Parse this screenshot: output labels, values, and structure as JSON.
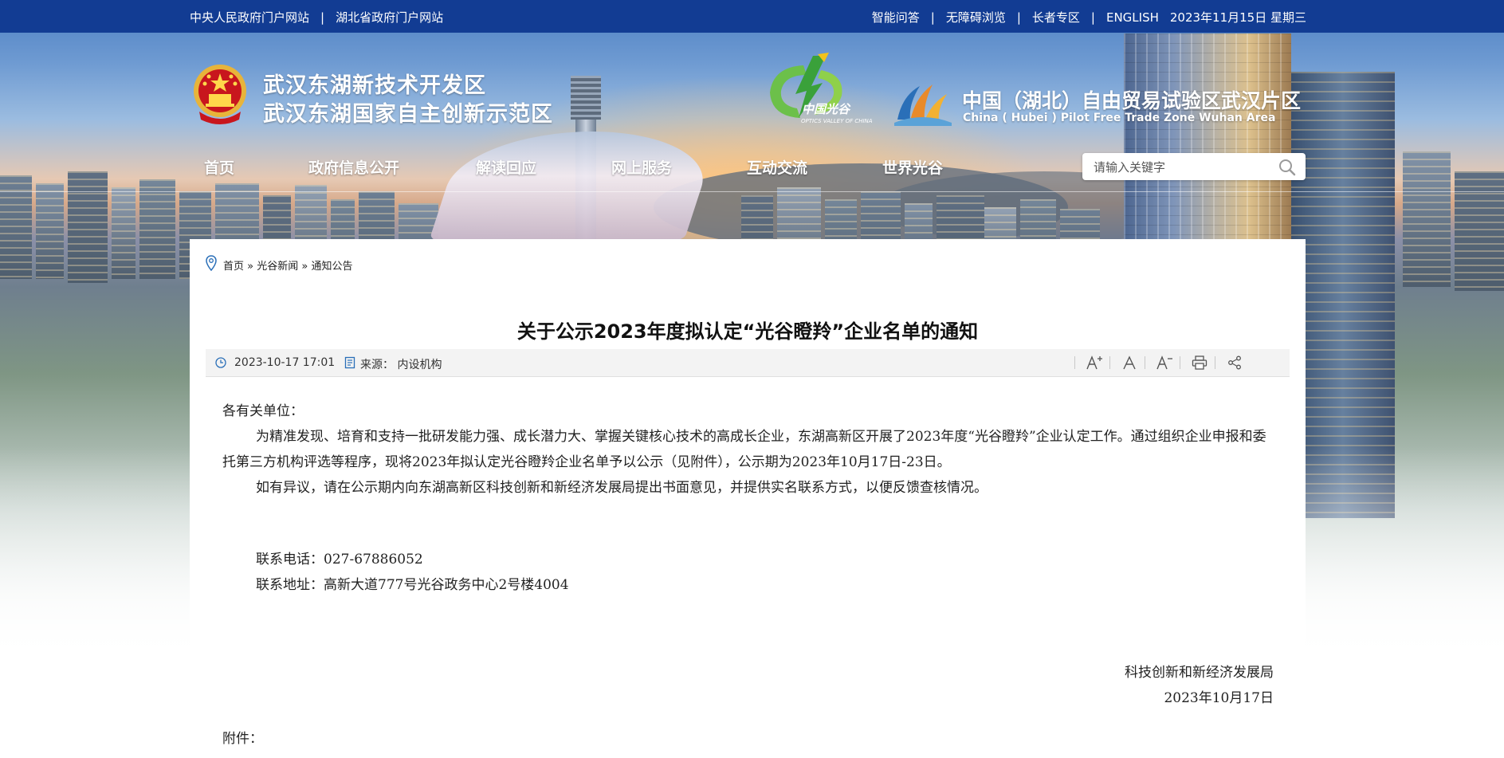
{
  "topbar": {
    "links_left": [
      "中央人民政府门户网站",
      "湖北省政府门户网站"
    ],
    "links_right": [
      "智能问答",
      "无障碍浏览",
      "长者专区",
      "ENGLISH"
    ],
    "date": "2023年11月15日 星期三"
  },
  "header": {
    "title_line1": "武汉东湖新技术开发区",
    "title_line2": "武汉东湖国家自主创新示范区",
    "ov_logo_cn": "中国光谷",
    "ov_logo_en": "OPTICS VALLEY OF CHINA",
    "ftz_cn": "中国（湖北）自由贸易试验区武汉片区",
    "ftz_en": "China ( Hubei ) Pilot Free Trade Zone Wuhan Area"
  },
  "nav": [
    "首页",
    "政府信息公开",
    "解读回应",
    "网上服务",
    "互动交流",
    "世界光谷"
  ],
  "search": {
    "placeholder": "请输入关键字"
  },
  "breadcrumb": [
    "首页",
    "光谷新闻",
    "通知公告"
  ],
  "article": {
    "title": "关于公示2023年度拟认定“光谷瞪羚”企业名单的通知",
    "datetime": "2023-10-17 17:01",
    "source": "来源：  内设机构",
    "greeting": "各有关单位：",
    "para1": "为精准发现、培育和支持一批研发能力强、成长潜力大、掌握关键核心技术的高成长企业，东湖高新区开展了2023年度“光谷瞪羚”企业认定工作。通过组织企业申报和委托第三方机构评选等程序，现将2023年拟认定光谷瞪羚企业名单予以公示（见附件），公示期为2023年10月17日-23日。",
    "para2": "如有异议，请在公示期内向东湖高新区科技创新和新经济发展局提出书面意见，并提供实名联系方式，以便反馈查核情况。",
    "phone": "联系电话：027-67886052",
    "address": "联系地址：高新大道777号光谷政务中心2号楼4004",
    "signer": "科技创新和新经济发展局",
    "sign_date": "2023年10月17日",
    "attachment_label": "附件："
  },
  "colors": {
    "topbar": "#123c93",
    "brand_green": "#6cc04a",
    "ftz_orange": "#e98a2a"
  }
}
